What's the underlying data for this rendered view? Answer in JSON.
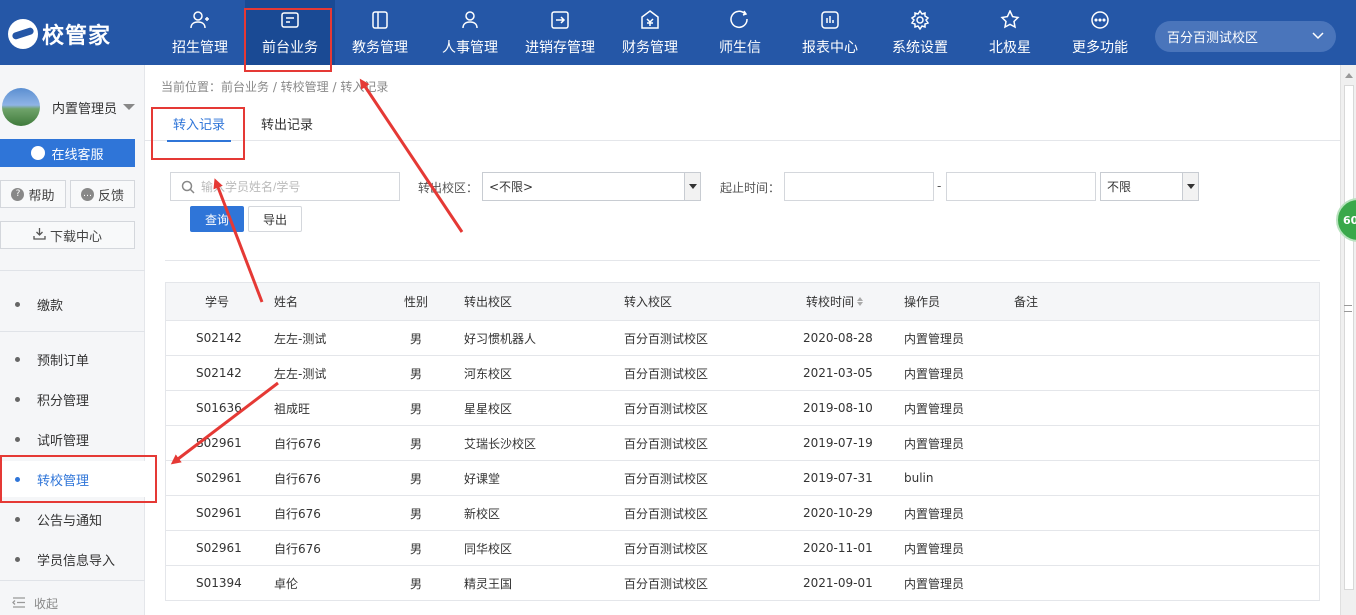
{
  "brand": {
    "logo_text": "校管家"
  },
  "nav": [
    {
      "label": "招生管理",
      "icon": "user-plus-icon",
      "active": false
    },
    {
      "label": "前台业务",
      "icon": "desk-icon",
      "active": true
    },
    {
      "label": "教务管理",
      "icon": "book-icon",
      "active": false
    },
    {
      "label": "人事管理",
      "icon": "person-icon",
      "active": false
    },
    {
      "label": "进销存管理",
      "icon": "inventory-icon",
      "active": false
    },
    {
      "label": "财务管理",
      "icon": "finance-icon",
      "active": false
    },
    {
      "label": "师生信",
      "icon": "message-icon",
      "active": false
    },
    {
      "label": "报表中心",
      "icon": "report-icon",
      "active": false
    },
    {
      "label": "系统设置",
      "icon": "gear-icon",
      "active": false
    },
    {
      "label": "北极星",
      "icon": "star-icon",
      "active": false
    },
    {
      "label": "更多功能",
      "icon": "more-icon",
      "active": false
    }
  ],
  "campus_select": {
    "value": "百分百测试校区"
  },
  "sidebar": {
    "user_name": "内置管理员",
    "service_label": "在线客服",
    "help_label": "帮助",
    "feedback_label": "反馈",
    "download_label": "下载中心",
    "menu_top": [
      {
        "label": "缴款"
      }
    ],
    "menu": [
      {
        "label": "预制订单",
        "active": false
      },
      {
        "label": "积分管理",
        "active": false
      },
      {
        "label": "试听管理",
        "active": false
      },
      {
        "label": "转校管理",
        "active": true
      },
      {
        "label": "公告与通知",
        "active": false
      },
      {
        "label": "学员信息导入",
        "active": false
      }
    ],
    "collapse_label": "收起"
  },
  "breadcrumb": "当前位置：前台业务 / 转校管理 / 转入记录",
  "tabs": [
    {
      "label": "转入记录",
      "active": true
    },
    {
      "label": "转出记录",
      "active": false
    }
  ],
  "filters": {
    "search_placeholder": "输入学员姓名/学号",
    "out_campus_label": "转出校区：",
    "out_campus_value": "<不限>",
    "time_label": "起止时间：",
    "time_sep": "-",
    "range_value": "不限",
    "query_label": "查询",
    "export_label": "导出"
  },
  "table": {
    "headers": [
      "学号",
      "姓名",
      "性别",
      "转出校区",
      "转入校区",
      "转校时间",
      "操作员",
      "备注"
    ],
    "rows": [
      [
        "S02142",
        "左左-测试",
        "男",
        "好习惯机器人",
        "百分百测试校区",
        "2020-08-28",
        "内置管理员",
        ""
      ],
      [
        "S02142",
        "左左-测试",
        "男",
        "河东校区",
        "百分百测试校区",
        "2021-03-05",
        "内置管理员",
        ""
      ],
      [
        "S01636",
        "祖成旺",
        "男",
        "星星校区",
        "百分百测试校区",
        "2019-08-10",
        "内置管理员",
        ""
      ],
      [
        "S02961",
        "自行676",
        "男",
        "艾瑞长沙校区",
        "百分百测试校区",
        "2019-07-19",
        "内置管理员",
        ""
      ],
      [
        "S02961",
        "自行676",
        "男",
        "好课堂",
        "百分百测试校区",
        "2019-07-31",
        "bulin",
        ""
      ],
      [
        "S02961",
        "自行676",
        "男",
        "新校区",
        "百分百测试校区",
        "2020-10-29",
        "内置管理员",
        ""
      ],
      [
        "S02961",
        "自行676",
        "男",
        "同华校区",
        "百分百测试校区",
        "2020-11-01",
        "内置管理员",
        ""
      ],
      [
        "S01394",
        "卓伦",
        "男",
        "精灵王国",
        "百分百测试校区",
        "2021-09-01",
        "内置管理员",
        ""
      ]
    ]
  },
  "float_badge": "60",
  "colors": {
    "nav_bg": "#2557a7",
    "accent": "#2f75d8",
    "annotation": "#e53935"
  }
}
